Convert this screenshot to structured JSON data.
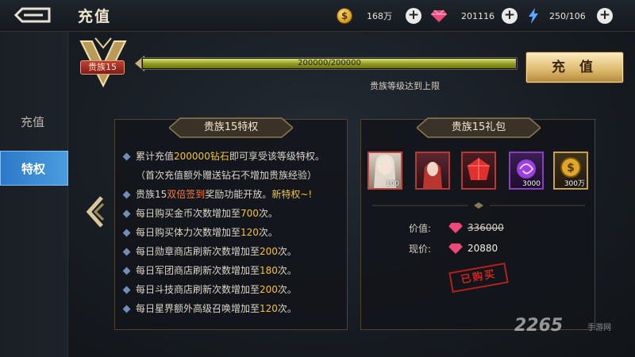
{
  "header": {
    "title": "充值"
  },
  "resources": {
    "gold": {
      "icon": "gold-coin-icon",
      "value": "168万"
    },
    "diamond": {
      "icon": "diamond-gem-icon",
      "value": "201116"
    },
    "stamina": {
      "icon": "lightning-bolt-icon",
      "value": "250/106"
    }
  },
  "sidebar": {
    "items": [
      {
        "label": "充值"
      },
      {
        "label": "特权",
        "active": true
      }
    ]
  },
  "noble": {
    "badge_label": "贵族15",
    "progress_text": "200000/200000",
    "progress_fraction": 1.0,
    "note": "贵族等级达到上限",
    "recharge_button": "充 值"
  },
  "privileges": {
    "title": "贵族15特权",
    "items": [
      {
        "parts": [
          {
            "t": "累计充值"
          },
          {
            "t": "200000钻石",
            "c": "gold"
          },
          {
            "t": "即可享受该等级特权。"
          }
        ]
      },
      {
        "parts": [
          {
            "t": "（首次充值额外赠送钻石不增加贵族经验）"
          }
        ],
        "nodot": true
      },
      {
        "parts": [
          {
            "t": "贵族15"
          },
          {
            "t": "双倍签到",
            "c": "red"
          },
          {
            "t": "奖励功能开放。"
          },
          {
            "t": "新特权~!",
            "c": "gold"
          }
        ]
      },
      {
        "parts": [
          {
            "t": "每日购买金币次数增加至"
          },
          {
            "t": "700",
            "c": "gold"
          },
          {
            "t": "次。"
          }
        ]
      },
      {
        "parts": [
          {
            "t": "每日购买体力次数增加至"
          },
          {
            "t": "120",
            "c": "gold"
          },
          {
            "t": "次。"
          }
        ]
      },
      {
        "parts": [
          {
            "t": "每日勋章商店刷新次数增加至"
          },
          {
            "t": "200",
            "c": "gold"
          },
          {
            "t": "次。"
          }
        ]
      },
      {
        "parts": [
          {
            "t": "每日军团商店刷新次数增加至"
          },
          {
            "t": "180",
            "c": "gold"
          },
          {
            "t": "次。"
          }
        ]
      },
      {
        "parts": [
          {
            "t": "每日斗技商店刷新次数增加至"
          },
          {
            "t": "200",
            "c": "gold"
          },
          {
            "t": "次。"
          }
        ]
      },
      {
        "parts": [
          {
            "t": "每日星界额外高级召唤增加至"
          },
          {
            "t": "120",
            "c": "gold"
          },
          {
            "t": "次。"
          }
        ]
      }
    ]
  },
  "gift": {
    "title": "贵族15礼包",
    "items": [
      {
        "icon": "hero-portrait-icon",
        "qty": "100"
      },
      {
        "icon": "hero-portrait-icon",
        "qty": ""
      },
      {
        "icon": "red-gem-icon",
        "qty": ""
      },
      {
        "icon": "purple-swirl-icon",
        "qty": "3000"
      },
      {
        "icon": "gold-coin-icon",
        "qty": "300万"
      }
    ],
    "original_label": "价值:",
    "original_price": "336000",
    "current_label": "现价:",
    "current_price": "20880",
    "status_stamp": "已购买"
  },
  "watermark": {
    "text": "2265",
    "sub": "手游网"
  }
}
